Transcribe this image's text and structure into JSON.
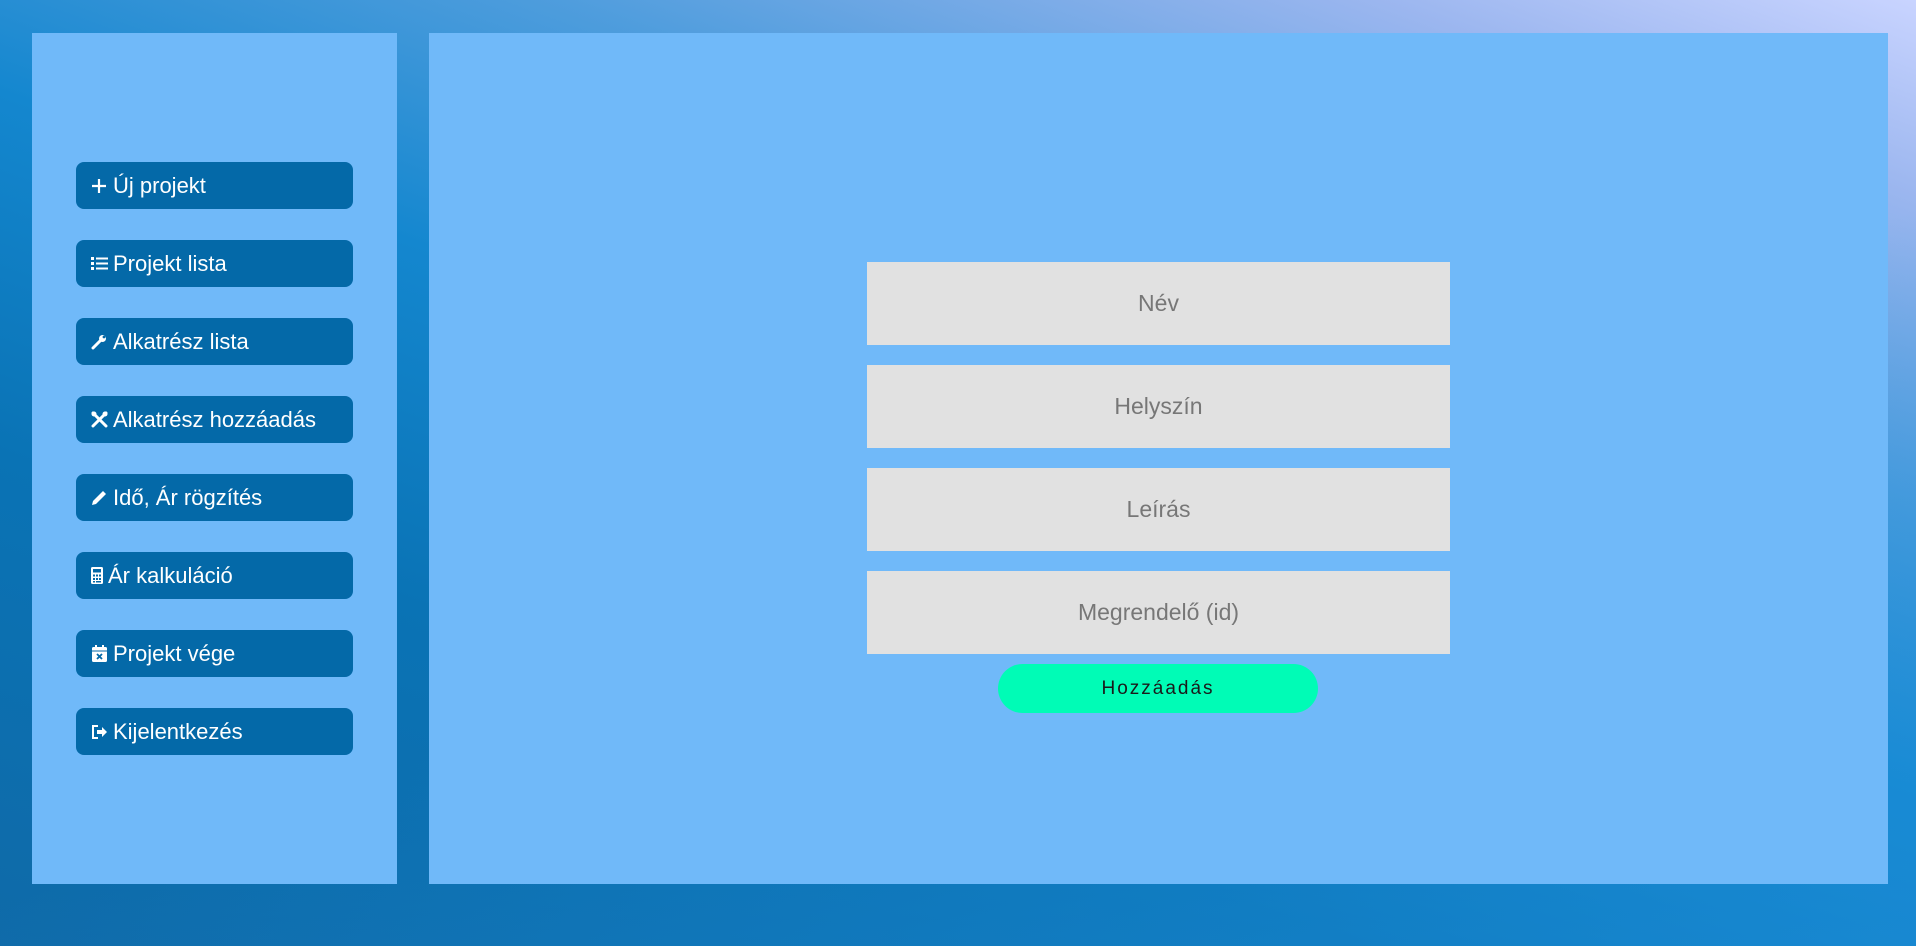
{
  "sidebar": {
    "items": [
      {
        "label": "Új projekt",
        "icon": "plus-icon"
      },
      {
        "label": "Projekt lista",
        "icon": "list-icon"
      },
      {
        "label": "Alkatrész lista",
        "icon": "wrench-icon"
      },
      {
        "label": "Alkatrész hozzáadás",
        "icon": "tools-icon"
      },
      {
        "label": "Idő, Ár rögzítés",
        "icon": "pencil-icon"
      },
      {
        "label": "Ár kalkuláció",
        "icon": "calculator-icon"
      },
      {
        "label": "Projekt vége",
        "icon": "calendar-x-icon"
      },
      {
        "label": "Kijelentkezés",
        "icon": "sign-out-icon"
      }
    ]
  },
  "form": {
    "fields": [
      {
        "placeholder": "Név",
        "value": ""
      },
      {
        "placeholder": "Helyszín",
        "value": ""
      },
      {
        "placeholder": "Leírás",
        "value": ""
      },
      {
        "placeholder": "Megrendelő (id)",
        "value": ""
      }
    ],
    "submit_label": "Hozzáadás"
  },
  "colors": {
    "panel": "#70b9f9",
    "nav_button": "#0469a8",
    "input_bg": "#e1e1e1",
    "submit_bg": "#00fcb6"
  }
}
